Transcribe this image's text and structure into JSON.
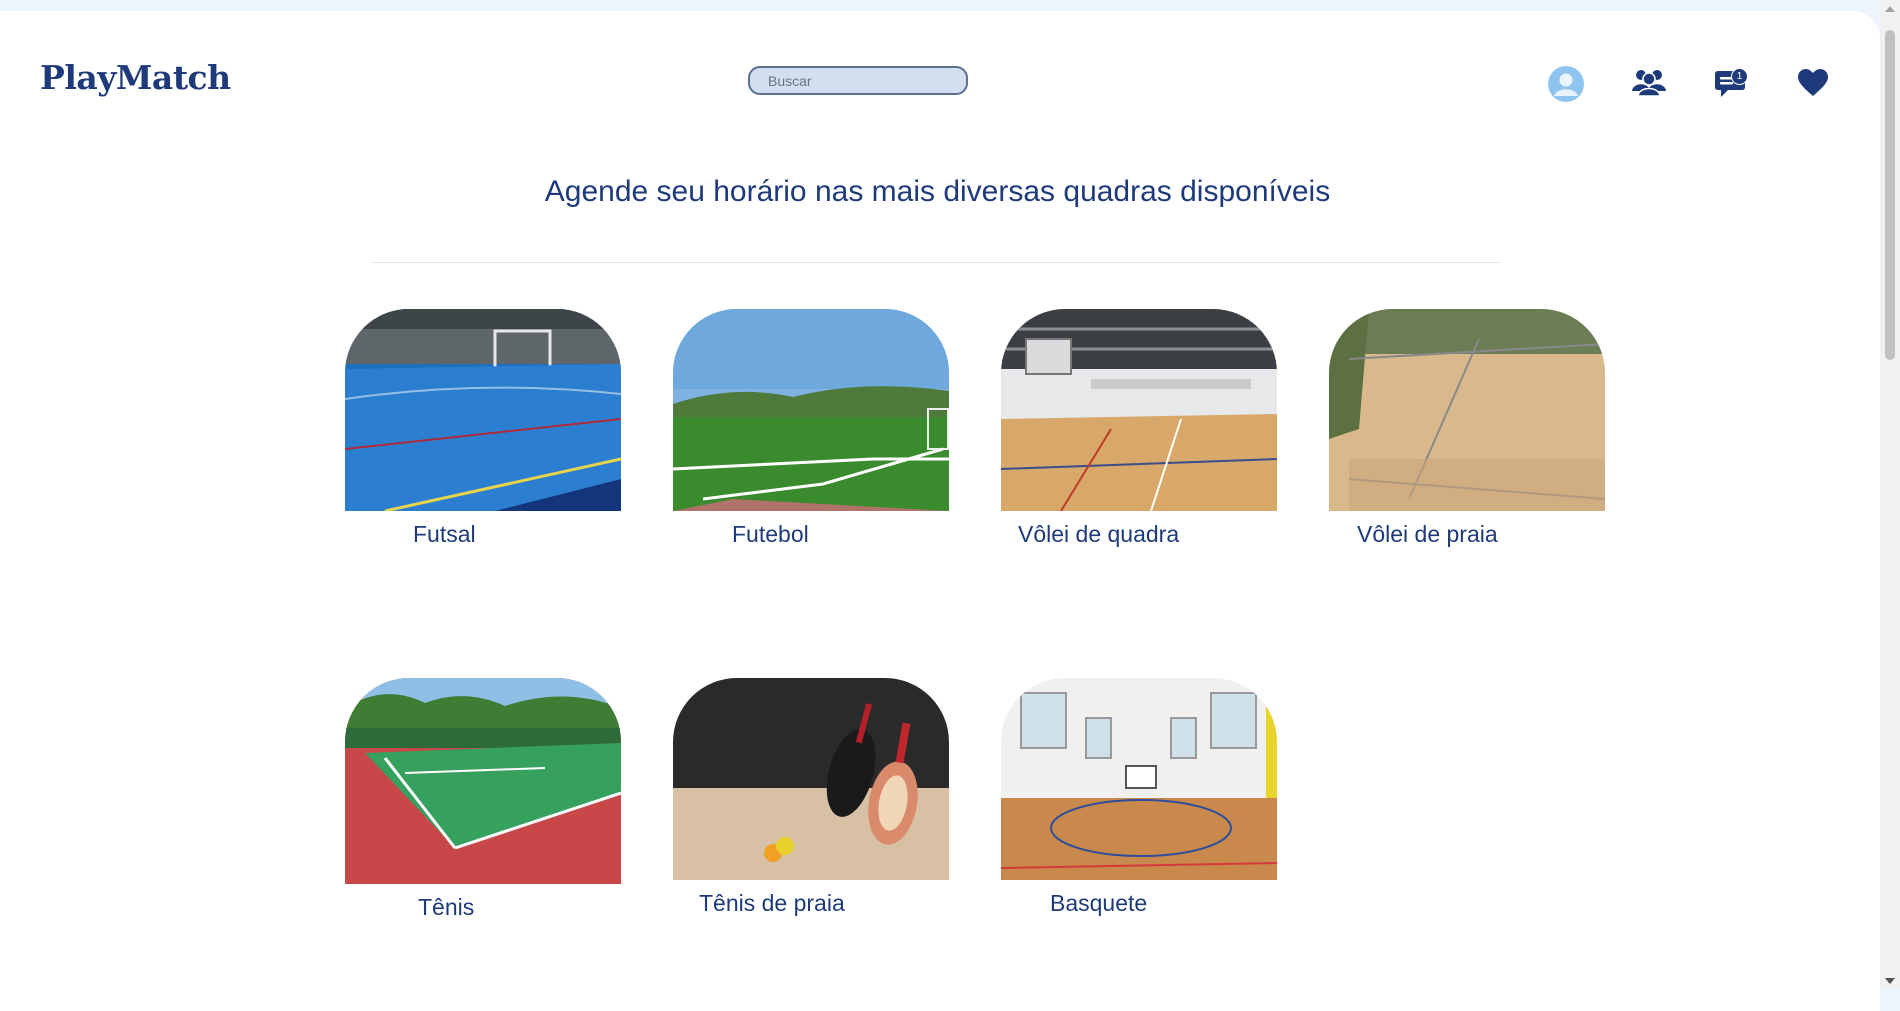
{
  "app": {
    "logo": "PlayMatch"
  },
  "search": {
    "placeholder": "Buscar"
  },
  "header_icons": {
    "profile": "avatar-icon",
    "friends": "group-icon",
    "messages": "chat-icon",
    "messages_badge": "1",
    "favorites": "heart-icon"
  },
  "main": {
    "headline": "Agende seu horário nas mais diversas quadras disponíveis",
    "courts": [
      {
        "label": "Futsal"
      },
      {
        "label": "Futebol"
      },
      {
        "label": "Vôlei de quadra"
      },
      {
        "label": "Vôlei de praia"
      },
      {
        "label": "Tênis"
      },
      {
        "label": "Tênis de praia"
      },
      {
        "label": "Basquete"
      }
    ]
  },
  "colors": {
    "brand": "#1e3a7b",
    "search_bg": "#d3dff0",
    "avatar": "#8fc4f0",
    "page_bg": "#eef4fb"
  }
}
